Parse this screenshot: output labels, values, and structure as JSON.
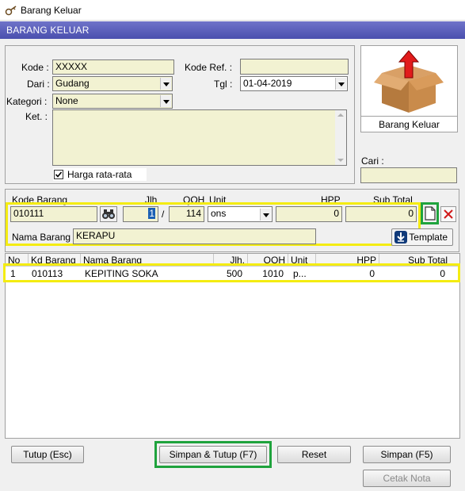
{
  "window": {
    "title": "Barang Keluar"
  },
  "header": {
    "title": "BARANG KELUAR"
  },
  "form": {
    "kode_label": "Kode :",
    "kode_value": "XXXXX",
    "dari_label": "Dari :",
    "dari_value": "Gudang",
    "kategori_label": "Kategori :",
    "kategori_value": "None",
    "ket_label": "Ket. :",
    "ket_value": "",
    "harga_label": "Harga rata-rata",
    "harga_checked": true,
    "kode_ref_label": "Kode Ref. :",
    "kode_ref_value": "",
    "tgl_label": "Tgl :",
    "tgl_value": "01-04-2019"
  },
  "side": {
    "image_label": "Barang Keluar",
    "cari_label": "Cari :",
    "cari_value": ""
  },
  "entry": {
    "kode_barang_label": "Kode Barang",
    "jlh_label": "Jlh",
    "qoh_label": "QOH",
    "unit_label": "Unit",
    "hpp_label": "HPP",
    "subtotal_label": "Sub Total",
    "kode_barang_value": "010111",
    "jlh_value": "1",
    "slash": "/",
    "qoh_value": "114",
    "unit_value": "ons",
    "hpp_value": "0",
    "subtotal_value": "0",
    "nama_barang_label": "Nama Barang",
    "nama_barang_value": "KERAPU",
    "template_label": "Template"
  },
  "table": {
    "columns": [
      "No",
      "Kd Barang",
      "Nama Barang",
      "Jlh.",
      "QOH",
      "Unit",
      "HPP",
      "Sub Total"
    ],
    "rows": [
      [
        "1",
        "010113",
        "KEPITING SOKA",
        "500",
        "1010",
        "p...",
        "0",
        "0"
      ]
    ]
  },
  "buttons": {
    "tutup": "Tutup (Esc)",
    "simpan_tutup": "Simpan & Tutup (F7)",
    "reset": "Reset",
    "simpan": "Simpan (F5)",
    "cetak": "Cetak Nota"
  },
  "colors": {
    "field_bg": "#f2f2d2",
    "header_band": "#5a5fbd",
    "highlight_yellow": "#f4ec12",
    "highlight_green": "#1fa33d"
  }
}
